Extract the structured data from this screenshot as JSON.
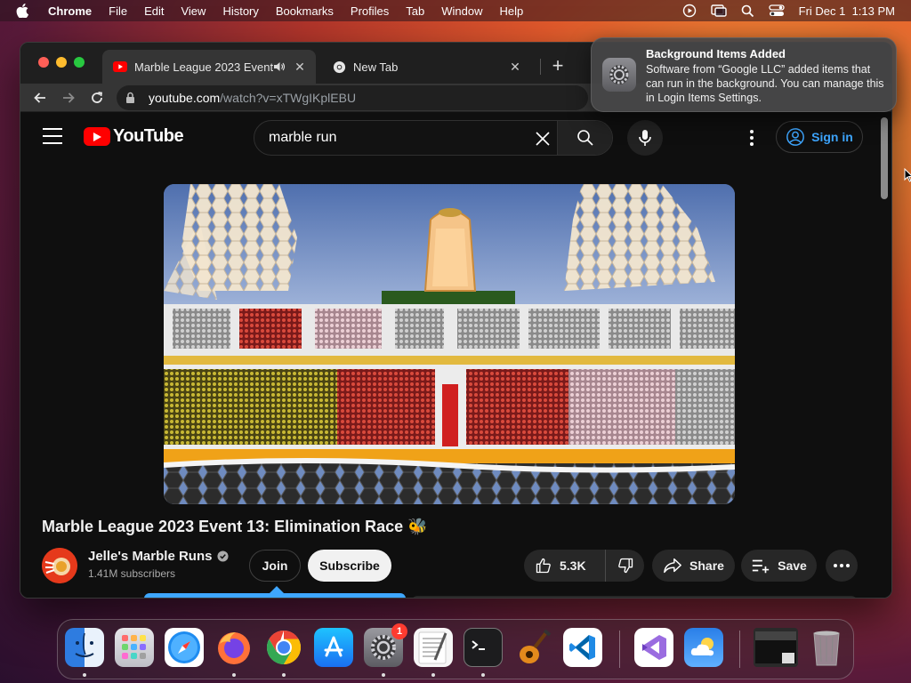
{
  "menubar": {
    "app_name": "Chrome",
    "items": [
      "File",
      "Edit",
      "View",
      "History",
      "Bookmarks",
      "Profiles",
      "Tab",
      "Window",
      "Help"
    ],
    "datetime": "Fri Dec 1  1:13 PM"
  },
  "browser": {
    "tabs": [
      {
        "title": "Marble League 2023 Event",
        "active": true,
        "audio": true
      },
      {
        "title": "New Tab",
        "active": false
      }
    ],
    "url_host": "youtube.com",
    "url_path": "/watch?v=xTWgIKplEBU"
  },
  "youtube": {
    "logo_text": "YouTube",
    "search_value": "marble run",
    "signin_label": "Sign in",
    "video_title": "Marble League 2023 Event 13: Elimination Race 🐝",
    "channel_name": "Jelle's Marble Runs",
    "subscribers": "1.41M subscribers",
    "join_label": "Join",
    "subscribe_label": "Subscribe",
    "like_count": "5.3K",
    "share_label": "Share",
    "save_label": "Save",
    "accent_color": "#ff0000",
    "link_color": "#3ea6ff"
  },
  "notification": {
    "title": "Background Items Added",
    "body": "Software from “Google LLC” added items that can run in the background. You can manage this in Login Items Settings."
  },
  "dock": {
    "apps": [
      "finder",
      "launchpad",
      "safari",
      "firefox",
      "chrome",
      "app-store",
      "system-settings",
      "textedit",
      "terminal",
      "garageband",
      "vscode",
      "visual-studio",
      "weather",
      "window-preview",
      "trash"
    ],
    "system_settings_badge": "1"
  }
}
